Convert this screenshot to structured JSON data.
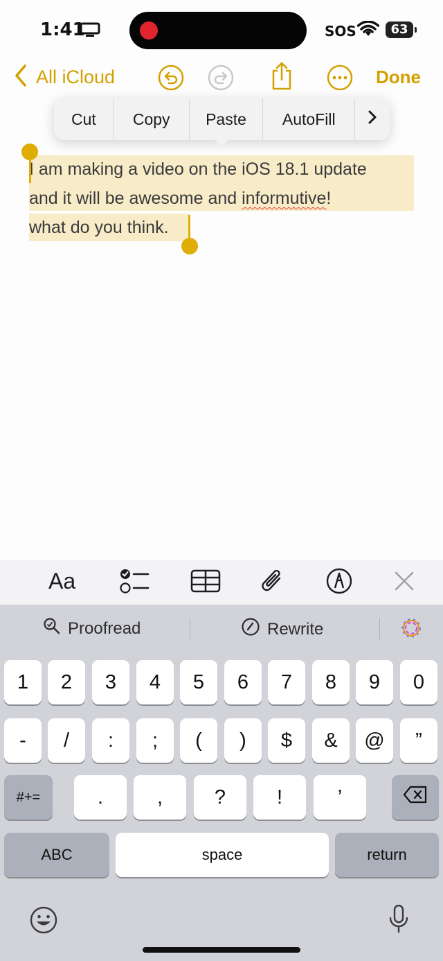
{
  "status": {
    "time": "1:41",
    "sos": "SOS",
    "battery": "63"
  },
  "nav": {
    "back_label": "All iCloud",
    "done_label": "Done"
  },
  "context_menu": {
    "items": [
      "Cut",
      "Copy",
      "Paste",
      "AutoFill"
    ]
  },
  "note": {
    "line1": "I am making a video on the iOS 18.1 update",
    "line2_a": "and it will be awesome and ",
    "line2_misspelled": "informutive",
    "line2_b": "!",
    "line3": "what do you think."
  },
  "toolbar": {
    "format_label": "Aa"
  },
  "suggestions": {
    "proofread": "Proofread",
    "rewrite": "Rewrite"
  },
  "keyboard": {
    "row1": [
      "1",
      "2",
      "3",
      "4",
      "5",
      "6",
      "7",
      "8",
      "9",
      "0"
    ],
    "row2": [
      "-",
      "/",
      ":",
      ";",
      "(",
      ")",
      "$",
      "&",
      "@",
      "”"
    ],
    "row3": [
      ".",
      ",",
      "?",
      "!",
      "’"
    ],
    "symbols_label": "#+=",
    "abc_label": "ABC",
    "space_label": "space",
    "return_label": "return"
  },
  "colors": {
    "accent": "#d4a000",
    "selection": "#f7ecc7",
    "handle": "#e0ad06"
  },
  "icons": [
    "chevron-left-icon",
    "undo-icon",
    "redo-icon",
    "share-icon",
    "more-icon",
    "chevron-right-icon",
    "checklist-icon",
    "table-icon",
    "attachment-icon",
    "markup-icon",
    "close-icon",
    "search-icon",
    "rewrite-icon",
    "apple-intelligence-icon",
    "delete-icon",
    "emoji-icon",
    "microphone-icon",
    "screen-mirroring-icon",
    "wifi-icon"
  ]
}
